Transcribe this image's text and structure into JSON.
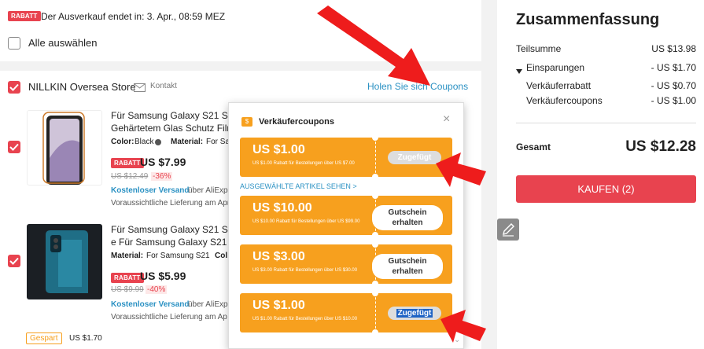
{
  "banner": {
    "tag": "RABATT",
    "text": "Der Ausverkauf endet in: 3. Apr., 08:59 MEZ"
  },
  "select_all": {
    "label": "Alle auswählen"
  },
  "store": {
    "name": "NILLKIN Oversea Store",
    "contact": "Kontakt",
    "coupons_link": "Holen Sie sich Coupons"
  },
  "products": [
    {
      "title_line1": "Für Samsung Galaxy S21 S21",
      "title_line2": "Gehärtetem Glas Schutz Film",
      "color_label": "Color:",
      "color_value": "Black",
      "material_label": "Material:",
      "material_value": "For Sa",
      "tag": "RABATT",
      "price": "US $7.99",
      "old_price": "US $12.49",
      "discount": "-36%",
      "shipping_link": "Kostenloser Versand",
      "shipping_text": "über AliExp",
      "delivery": "Voraussichtliche Lieferung am Apr"
    },
    {
      "title_line1": "Für Samsung Galaxy S21 S21",
      "title_line2": "e Für Samsung Galaxy S21 Ul",
      "material_label": "Material:",
      "material_value": "For Samsung S21",
      "color_label": "Col",
      "tag": "RABATT",
      "price": "US $5.99",
      "old_price": "US $9.99",
      "discount": "-40%",
      "shipping_link": "Kostenloser Versand",
      "shipping_text": "über AliExp",
      "delivery": "Voraussichtliche Lieferung am Ap"
    }
  ],
  "saved": {
    "tag": "Gespart",
    "value": "US $1.70"
  },
  "coupon_popup": {
    "title": "Verkäufercoupons",
    "badge": "$",
    "close": "×",
    "see_items": "AUSGEWÄHLTE ARTIKEL SEHEN >",
    "coupons": [
      {
        "amount": "US $1.00",
        "desc": "US $1.00 Rabatt für Bestellungen über US $7.00",
        "button": "Zugefügt",
        "state": "disabled"
      },
      {
        "amount": "US $10.00",
        "desc": "US $10.00 Rabatt für Bestellungen über US $99.00",
        "button": "Gutschein erhalten",
        "state": "active"
      },
      {
        "amount": "US $3.00",
        "desc": "US $3.00 Rabatt für Bestellungen über US $30.00",
        "button": "Gutschein erhalten",
        "state": "active"
      },
      {
        "amount": "US $1.00",
        "desc": "US $1.00 Rabatt für Bestellungen über US $10.00",
        "button": "Zugefügt",
        "state": "selected"
      }
    ]
  },
  "summary": {
    "title": "Zusammenfassung",
    "subtotal_label": "Teilsumme",
    "subtotal_value": "US $13.98",
    "savings_label": "Einsparungen",
    "savings_value": "- US $1.70",
    "seller_discount_label": "Verkäuferrabatt",
    "seller_discount_value": "- US $0.70",
    "seller_coupons_label": "Verkäufercoupons",
    "seller_coupons_value": "- US $1.00",
    "total_label": "Gesamt",
    "total_value": "US $12.28",
    "buy_button": "KAUFEN (2)"
  },
  "colors": {
    "accent": "#e8434f",
    "coupon": "#f7a01e",
    "link": "#2a91c3",
    "arrow": "#ee1c1c"
  }
}
